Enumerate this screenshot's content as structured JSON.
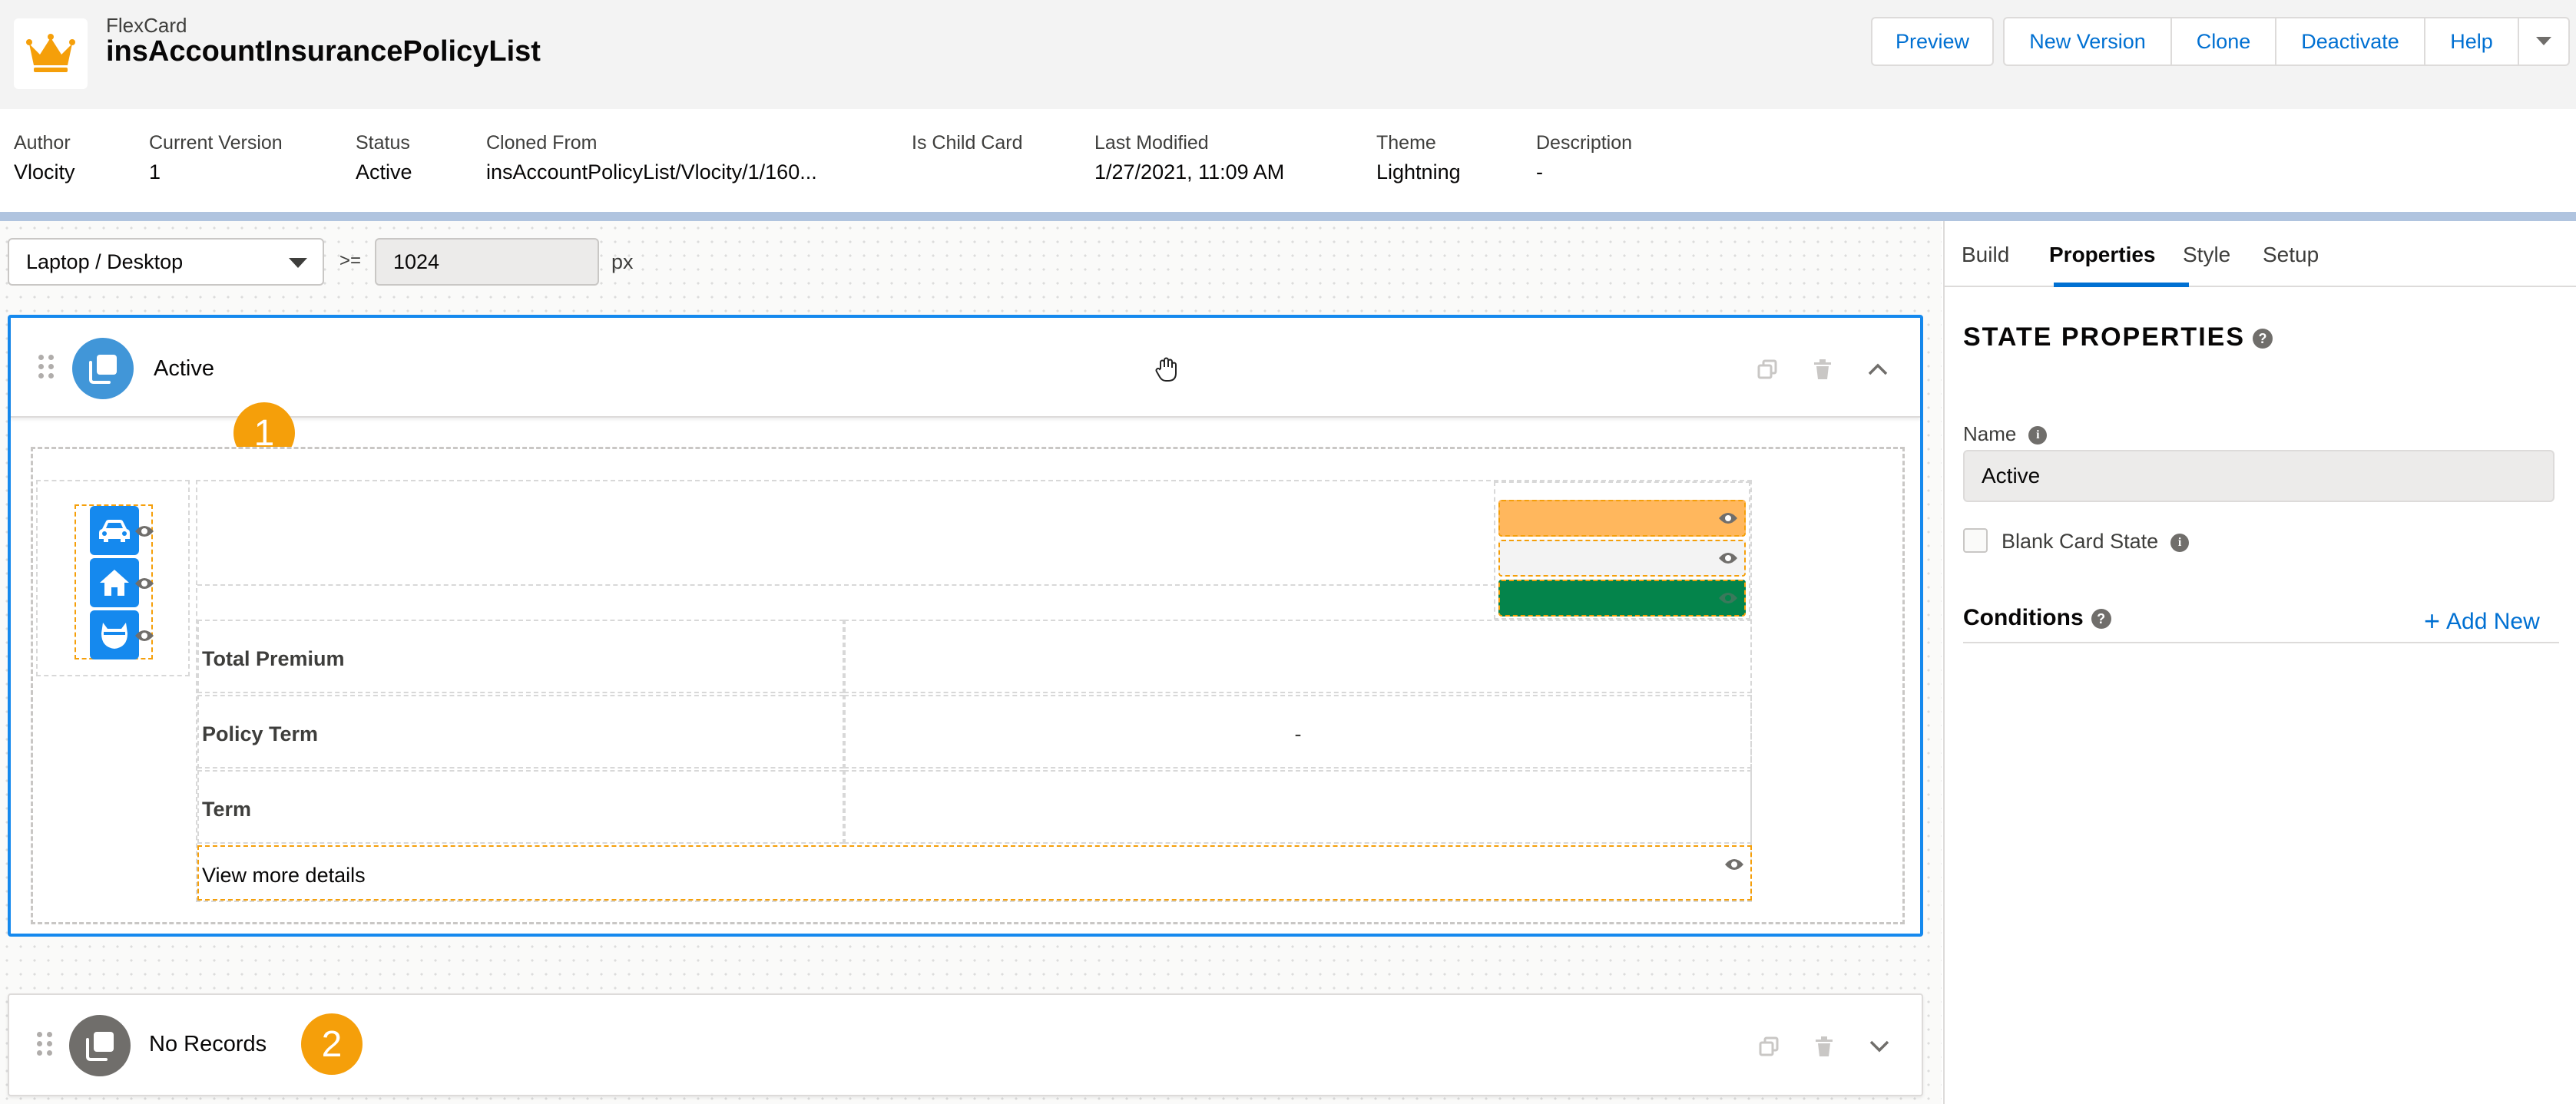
{
  "header": {
    "app_type": "FlexCard",
    "title": "insAccountInsurancePolicyList",
    "buttons": {
      "preview": "Preview",
      "new_version": "New Version",
      "clone": "Clone",
      "deactivate": "Deactivate",
      "help": "Help"
    }
  },
  "meta": [
    {
      "label": "Author",
      "value": "Vlocity"
    },
    {
      "label": "Current Version",
      "value": "1"
    },
    {
      "label": "Status",
      "value": "Active"
    },
    {
      "label": "Cloned From",
      "value": "insAccountPolicyList/Vlocity/1/160..."
    },
    {
      "label": "Is Child Card",
      "value": ""
    },
    {
      "label": "Last Modified",
      "value": "1/27/2021, 11:09 AM"
    },
    {
      "label": "Theme",
      "value": "Lightning"
    },
    {
      "label": "Description",
      "value": "-"
    }
  ],
  "toolbar": {
    "device": "Laptop / Desktop",
    "operator": ">=",
    "width_value": "1024",
    "unit": "px"
  },
  "states": [
    {
      "name": "Active",
      "marker": "1",
      "rows": [
        {
          "label": "Total Premium",
          "value": ""
        },
        {
          "label": "Policy Term",
          "value": "-"
        },
        {
          "label": "Term",
          "value": ""
        }
      ],
      "link": "View more details",
      "policy_icons": [
        "car-icon",
        "home-icon",
        "pet-icon"
      ],
      "bar_colors": [
        "#ffb75d",
        "#f3f3f3",
        "#04844b"
      ]
    },
    {
      "name": "No Records",
      "marker": "2"
    }
  ],
  "panel": {
    "tabs": [
      "Build",
      "Properties",
      "Style",
      "Setup"
    ],
    "active_tab": "Properties",
    "section_title": "STATE PROPERTIES",
    "name_label": "Name",
    "name_value": "Active",
    "blank_state_label": "Blank Card State",
    "conditions_label": "Conditions",
    "add_new_label": "Add New"
  },
  "colors": {
    "accent": "#0070d2",
    "selected_border": "#1589ee",
    "marker": "#f59f0a",
    "state_active_icon": "#4196d8",
    "state_norecords_icon": "#706e6b"
  }
}
